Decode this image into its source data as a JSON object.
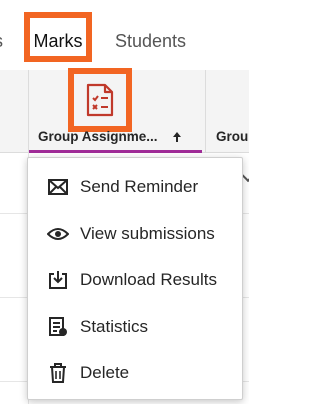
{
  "tabs": {
    "partial_label": "s",
    "marks_label": "Marks",
    "students_label": "Students"
  },
  "grid_header": {
    "column_1_title": "Group Assignme...",
    "column_2_title": "Grou",
    "column_1_icon": "assignment-icon"
  },
  "menu": {
    "items": [
      {
        "label": "Send Reminder",
        "icon": "envelope-icon"
      },
      {
        "label": "View submissions",
        "icon": "eye-icon"
      },
      {
        "label": "Download Results",
        "icon": "download-icon"
      },
      {
        "label": "Statistics",
        "icon": "statistics-icon"
      },
      {
        "label": "Delete",
        "icon": "trash-icon"
      }
    ]
  },
  "colors": {
    "highlight": "#f26522",
    "accent_underline": "#a02c98",
    "assignment_icon": "#c0392b"
  }
}
